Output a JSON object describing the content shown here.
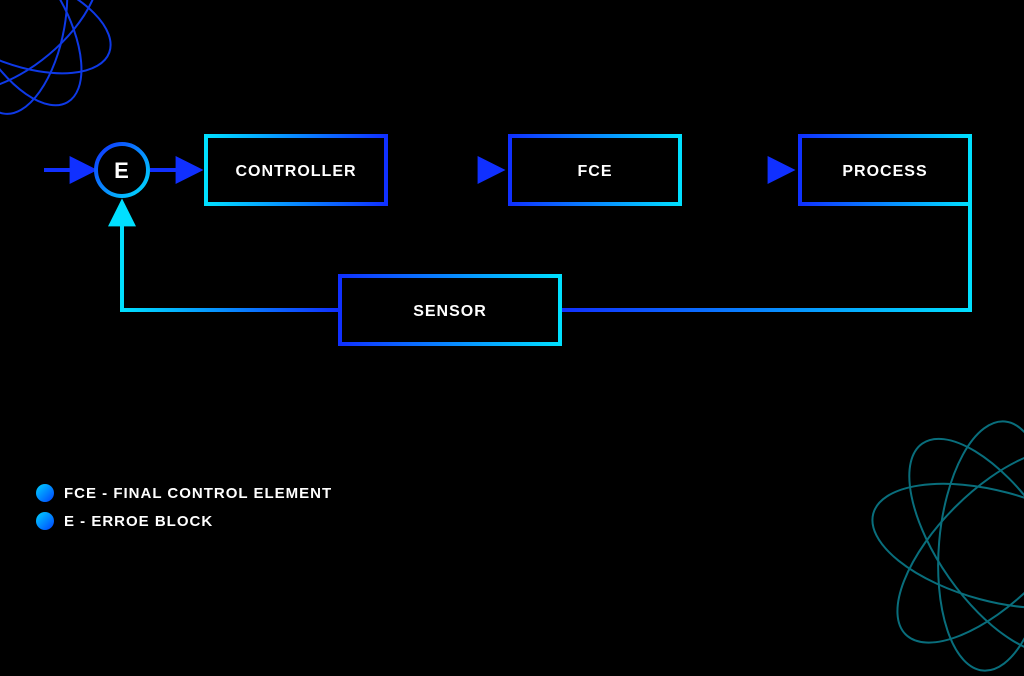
{
  "nodes": {
    "error": "E",
    "controller": "CONTROLLER",
    "fce": "FCE",
    "process": "PROCESS",
    "sensor": "SENSOR"
  },
  "legend": {
    "item1": "FCE - FINAL CONTROL ELEMENT",
    "item2": "E - ERROE BLOCK"
  },
  "colors": {
    "cyan": "#00e0ff",
    "blue": "#1030ff"
  }
}
